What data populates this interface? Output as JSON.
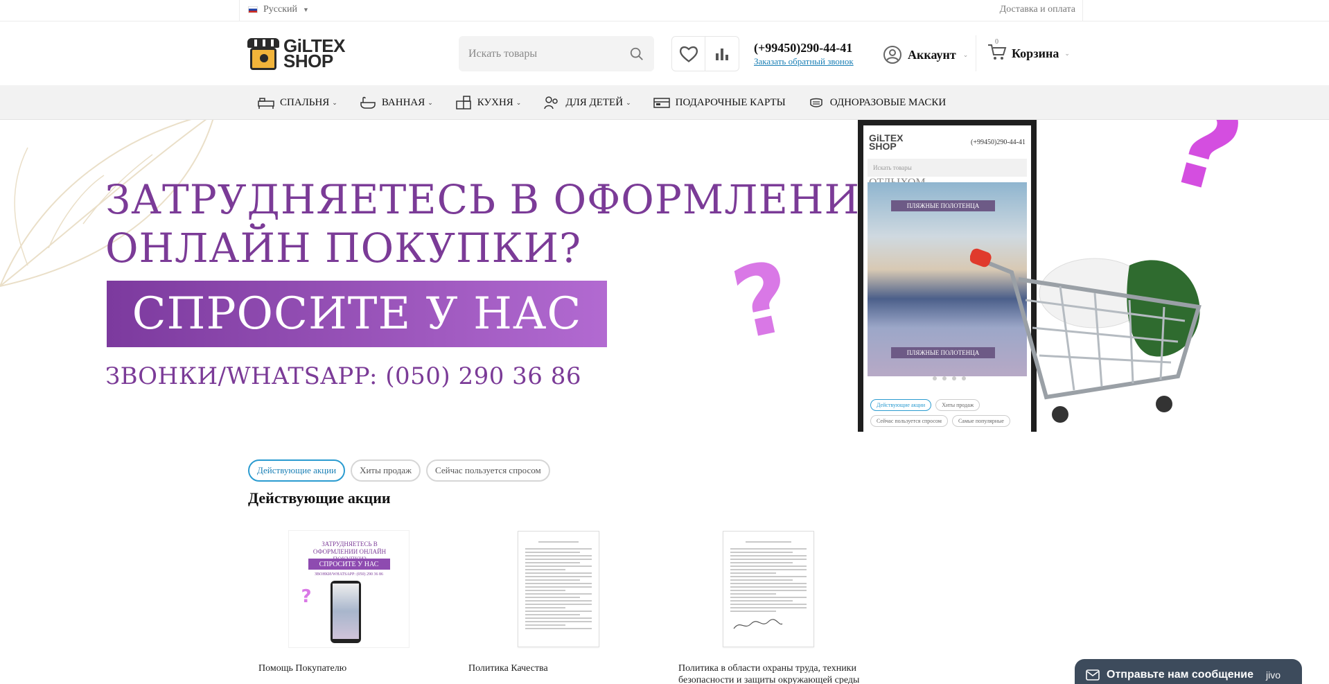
{
  "topbar": {
    "language": "Русский",
    "delivery_link": "Доставка и оплата"
  },
  "header": {
    "logo_line1": "GiLTEX",
    "logo_line2": "SHOP",
    "search_placeholder": "Искать товары",
    "phone": "(+99450)290-44-41",
    "callback_link": "Заказать обратный звонок",
    "account_label": "Аккаунт",
    "cart_label": "Корзина",
    "cart_count": "0"
  },
  "nav": {
    "items": [
      {
        "label": "СПАЛЬНЯ",
        "icon": "bed-icon",
        "dropdown": true
      },
      {
        "label": "ВАННАЯ",
        "icon": "bathtub-icon",
        "dropdown": true
      },
      {
        "label": "КУХНЯ",
        "icon": "kitchen-icon",
        "dropdown": true
      },
      {
        "label": "ДЛЯ ДЕТЕЙ",
        "icon": "kids-icon",
        "dropdown": true
      },
      {
        "label": "ПОДАРОЧНЫЕ КАРТЫ",
        "icon": "gift-card-icon",
        "dropdown": false
      },
      {
        "label": "ОДНОРАЗОВЫЕ МАСКИ",
        "icon": "mask-icon",
        "dropdown": false
      }
    ]
  },
  "banner": {
    "headline_line1": "ЗАТРУДНЯЕТЕСЬ В ОФОРМЛЕНИИ",
    "headline_line2": "ОНЛАЙН ПОКУПКИ?",
    "ask_text": "СПРОСИТЕ У НАС",
    "calls_text": "ЗВОНКИ/WHATSAPP: (050) 290 36 86",
    "accent_color": "#7b3b97",
    "phone_mock": {
      "logo_line1": "GiLTEX",
      "logo_line2": "SHOP",
      "phone": "(+99450)290-44-41",
      "search_placeholder": "Искать товары",
      "top_text": "ОТДЫХОМ",
      "label1": "ПЛЯЖНЫЕ ПОЛОТЕНЦА",
      "label2": "ПЛЯЖНЫЕ ПОЛОТЕНЦА",
      "pills": [
        "Действующие акции",
        "Хиты продаж",
        "Сейчас пользуется спросом",
        "Самые популярные"
      ]
    }
  },
  "tabs": {
    "items": [
      "Действующие акции",
      "Хиты продаж",
      "Сейчас пользуется спросом"
    ],
    "active_index": 0
  },
  "section_title": "Действующие акции",
  "promos": [
    {
      "caption": "Помощь Покупателю"
    },
    {
      "caption": "Политика Качества"
    },
    {
      "caption": "Политика в области охраны труда, техники безопасности и защиты окружающей среды"
    }
  ],
  "promo_thumb": {
    "headline": "ЗАТРУДНЯЕТЕСЬ В ОФОРМЛЕНИИ ОНЛАЙН ПОКУПКИ?",
    "ask_text": "СПРОСИТЕ У НАС",
    "calls_text": "ЗВОНКИ/WHATSAPP: (050) 290 36 86"
  },
  "chat": {
    "label": "Отправьте нам сообщение",
    "brand": "jivo"
  }
}
